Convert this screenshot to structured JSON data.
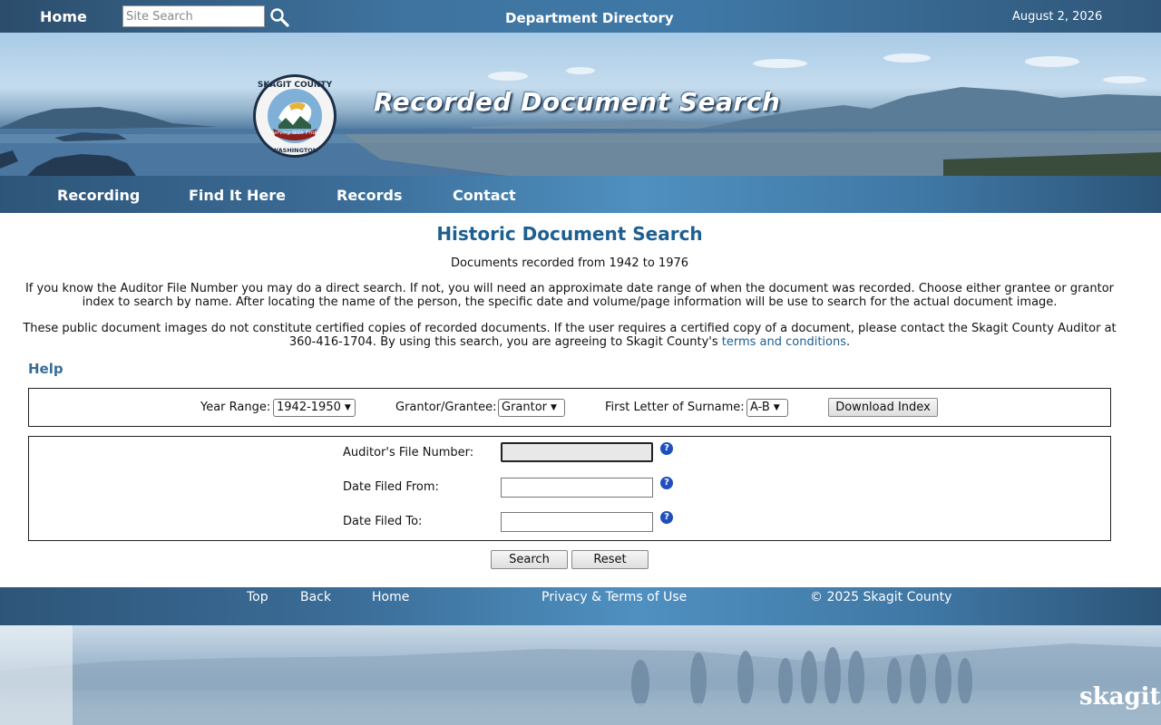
{
  "topbar": {
    "home_label": "Home",
    "search_placeholder": "Site Search",
    "search_icon": "magnifier-icon",
    "department_link": "Department Directory",
    "date": "August 2, 2026"
  },
  "banner": {
    "title": "Recorded Document Search",
    "seal": {
      "top_text": "SKAGIT COUNTY",
      "ribbon_text": "Serving With Pride",
      "bottom_text": "WASHINGTON"
    }
  },
  "nav": {
    "items": [
      {
        "label": "Recording"
      },
      {
        "label": "Find It Here"
      },
      {
        "label": "Records"
      },
      {
        "label": "Contact"
      }
    ]
  },
  "main": {
    "title": "Historic Document Search",
    "subtitle": "Documents recorded from 1942 to 1976",
    "intro_line1": "If you know the Auditor File Number you may do a direct search. If not, you will need an approximate date range of when the document was recorded. Choose either grantee or grantor",
    "intro_line2": "index to search by name. After locating the name of the person, the specific date and volume/page information will be use to search for the actual document image.",
    "notice_line1": "These public document images do not constitute certified copies of recorded documents. If the user requires a certified copy of a document, please contact the Skagit County Auditor at",
    "notice_line2_prefix": "360-416-1704. By using this search, you are agreeing to Skagit County's",
    "terms_link": "terms and conditions",
    "notice_line2_suffix": ".",
    "help_label": "Help"
  },
  "index_form": {
    "year_range_label": "Year Range:",
    "year_range_value": "1942-1950",
    "type_label": "Grantor/Grantee:",
    "type_value": "Grantor",
    "letter_label": "First Letter of Surname:",
    "letter_value": "A-B",
    "download_button": "Download Index"
  },
  "search_form": {
    "file_number_label": "Auditor's File Number:",
    "file_number_value": "",
    "date_from_label": "Date Filed From:",
    "date_from_value": "",
    "date_to_label": "Date Filed To:",
    "date_to_value": "",
    "help_icon": "question-icon",
    "help_glyph": "?",
    "search_button": "Search",
    "reset_button": "Reset"
  },
  "footer": {
    "links": [
      "Top",
      "Back",
      "Home"
    ],
    "privacy": "Privacy & Terms of Use",
    "copyright": "© 2025 Skagit County",
    "brand_text": "skagitco"
  },
  "colors": {
    "heading_blue": "#1d5f91",
    "bar_blue": "#3f74a0",
    "help_icon_blue": "#1f4fbf"
  }
}
